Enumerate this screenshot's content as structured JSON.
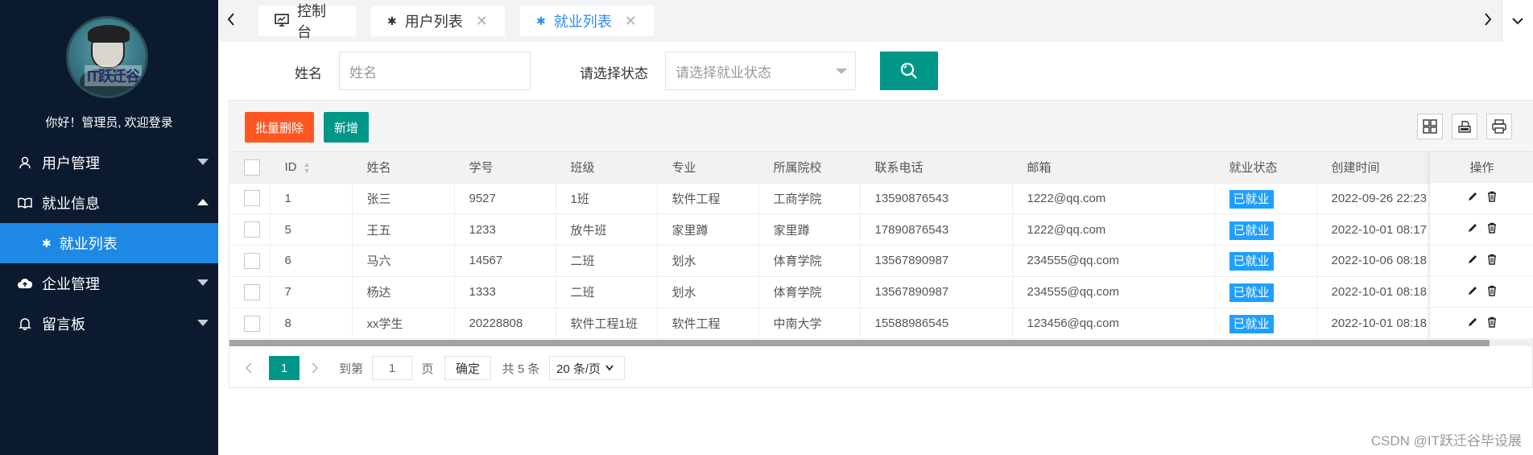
{
  "sidebar": {
    "welcome": "你好！管理员, 欢迎登录",
    "avatar_text": "IT跃迁谷",
    "items": [
      {
        "label": "用户管理",
        "icon": "user-icon"
      },
      {
        "label": "就业信息",
        "icon": "book-icon",
        "expanded": true
      },
      {
        "label": "企业管理",
        "icon": "cloud-upload-icon"
      },
      {
        "label": "留言板",
        "icon": "bell-icon"
      }
    ],
    "sub_item": {
      "label": "就业列表",
      "icon": "palm-icon"
    }
  },
  "tabs": [
    {
      "label": "控制台",
      "icon": "monitor-icon"
    },
    {
      "label": "用户列表",
      "icon": "palm-icon"
    },
    {
      "label": "就业列表",
      "icon": "palm-icon",
      "active": true
    }
  ],
  "search": {
    "name_label": "姓名",
    "name_placeholder": "姓名",
    "status_label": "请选择状态",
    "status_placeholder": "请选择就业状态"
  },
  "toolbar": {
    "batch_delete": "批量删除",
    "add": "新增"
  },
  "table": {
    "columns": [
      "ID",
      "姓名",
      "学号",
      "班级",
      "专业",
      "所属院校",
      "联系电话",
      "邮箱",
      "就业状态",
      "创建时间",
      "操作"
    ],
    "rows": [
      [
        "1",
        "张三",
        "9527",
        "1班",
        "软件工程",
        "工商学院",
        "13590876543",
        "1222@qq.com",
        "已就业",
        "2022-09-26 22:23"
      ],
      [
        "5",
        "王五",
        "1233",
        "放牛班",
        "家里蹲",
        "家里蹲",
        "17890876543",
        "1222@qq.com",
        "已就业",
        "2022-10-01 08:17"
      ],
      [
        "6",
        "马六",
        "14567",
        "二班",
        "划水",
        "体育学院",
        "13567890987",
        "234555@qq.com",
        "已就业",
        "2022-10-06 08:18"
      ],
      [
        "7",
        "杨达",
        "1333",
        "二班",
        "划水",
        "体育学院",
        "13567890987",
        "234555@qq.com",
        "已就业",
        "2022-10-01 08:18"
      ],
      [
        "8",
        "xx学生",
        "20228808",
        "软件工程1班",
        "软件工程",
        "中南大学",
        "15588986545",
        "123456@qq.com",
        "已就业",
        "2022-10-01 08:18"
      ]
    ]
  },
  "pager": {
    "current": "1",
    "goto_label": "到第",
    "goto_value": "1",
    "page_unit": "页",
    "confirm": "确定",
    "total": "共 5 条",
    "page_size": "20 条/页"
  },
  "colors": {
    "sidebar_bg": "#0b1a2e",
    "active_blue": "#1e88e5",
    "teal": "#009688",
    "danger": "#ff5722",
    "status_blue": "#1e9fff"
  },
  "watermark": "CSDN @IT跃迁谷毕设展"
}
